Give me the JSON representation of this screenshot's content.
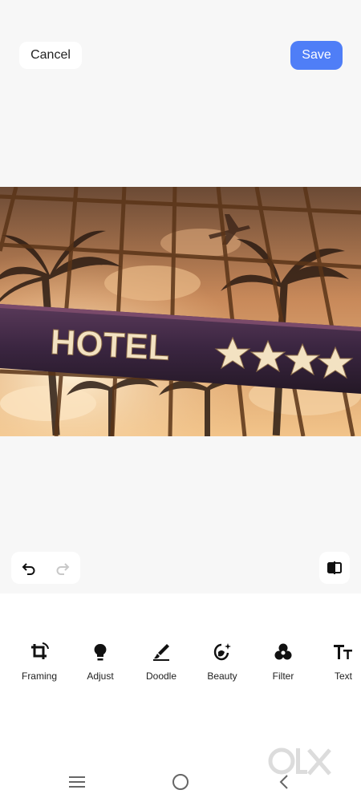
{
  "header": {
    "cancel_label": "Cancel",
    "save_label": "Save"
  },
  "photo": {
    "sign_text": "HOTEL",
    "star_count": 4
  },
  "history": {
    "undo_icon": "undo-icon",
    "redo_icon": "redo-icon",
    "compare_icon": "compare-icon"
  },
  "tools": [
    {
      "label": "Framing",
      "icon": "crop-rotate-icon"
    },
    {
      "label": "Adjust",
      "icon": "bulb-icon"
    },
    {
      "label": "Doodle",
      "icon": "brush-icon"
    },
    {
      "label": "Beauty",
      "icon": "face-sparkle-icon"
    },
    {
      "label": "Filter",
      "icon": "filter-circles-icon"
    },
    {
      "label": "Text",
      "icon": "text-icon"
    }
  ],
  "navbar": {
    "items": [
      "menu-icon",
      "home-icon",
      "back-icon"
    ]
  },
  "watermark": {
    "text": "OLX"
  },
  "colors": {
    "accent": "#4f7ef7",
    "background": "#f7f7f7",
    "panel": "#ffffff"
  }
}
